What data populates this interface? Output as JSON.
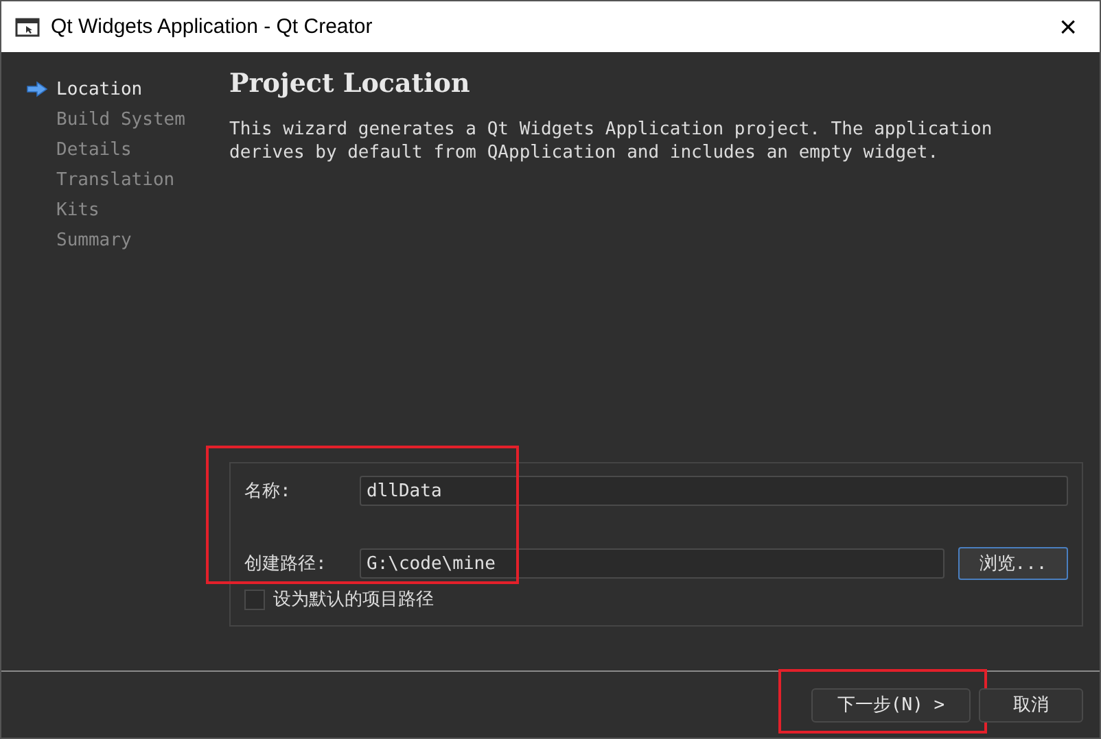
{
  "window": {
    "title": "Qt Widgets Application - Qt Creator",
    "close": "×"
  },
  "steps": [
    {
      "label": "Location",
      "selected": true
    },
    {
      "label": "Build System",
      "selected": false
    },
    {
      "label": "Details",
      "selected": false
    },
    {
      "label": "Translation",
      "selected": false
    },
    {
      "label": "Kits",
      "selected": false
    },
    {
      "label": "Summary",
      "selected": false
    }
  ],
  "page": {
    "title": "Project Location",
    "description": "This wizard generates a Qt Widgets Application project. The application derives by default from QApplication and includes an empty widget."
  },
  "form": {
    "highlighted": true,
    "name_label": "名称:",
    "name_value": "dllData",
    "path_label": "创建路径:",
    "path_value": "G:\\code\\mine",
    "browse": "浏览...",
    "default_checkbox": {
      "label": "设为默认的项目路径",
      "checked": false
    }
  },
  "buttons": [
    {
      "label": "下一步(N) >",
      "highlighted": true
    },
    {
      "label": "取消",
      "highlighted": false
    }
  ]
}
